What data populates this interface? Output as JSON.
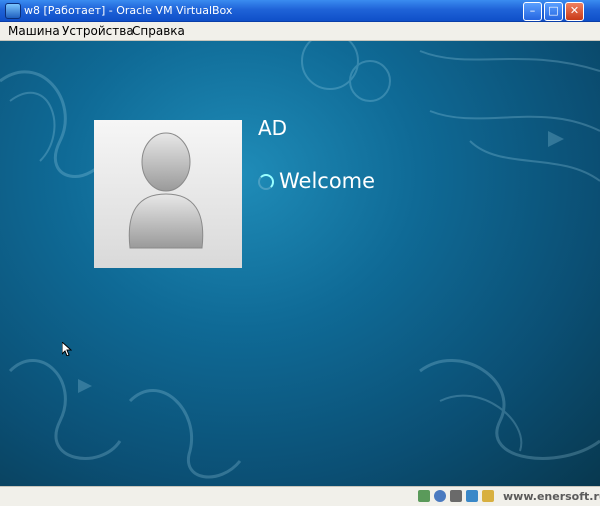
{
  "window": {
    "title": "w8 [Работает] - Oracle VM VirtualBox",
    "minimize_glyph": "–",
    "maximize_glyph": "□",
    "close_glyph": "✕"
  },
  "menu": {
    "items": [
      "Машина",
      "Устройства",
      "Справка"
    ]
  },
  "guest_screen": {
    "user_name": "AD",
    "status_text": "Welcome"
  },
  "status_bar": {
    "icons": [
      "hard-disk-icon",
      "cd-icon",
      "usb-icon",
      "network-icon",
      "shared-folders-icon",
      "display-icon",
      "capture-icon"
    ],
    "watermark": "www.enersoft.ru"
  },
  "colors": {
    "titlebar_blue": "#1f63d8",
    "desktop_teal": "#0f6a96",
    "menubar_bg": "#f1f0ea"
  }
}
